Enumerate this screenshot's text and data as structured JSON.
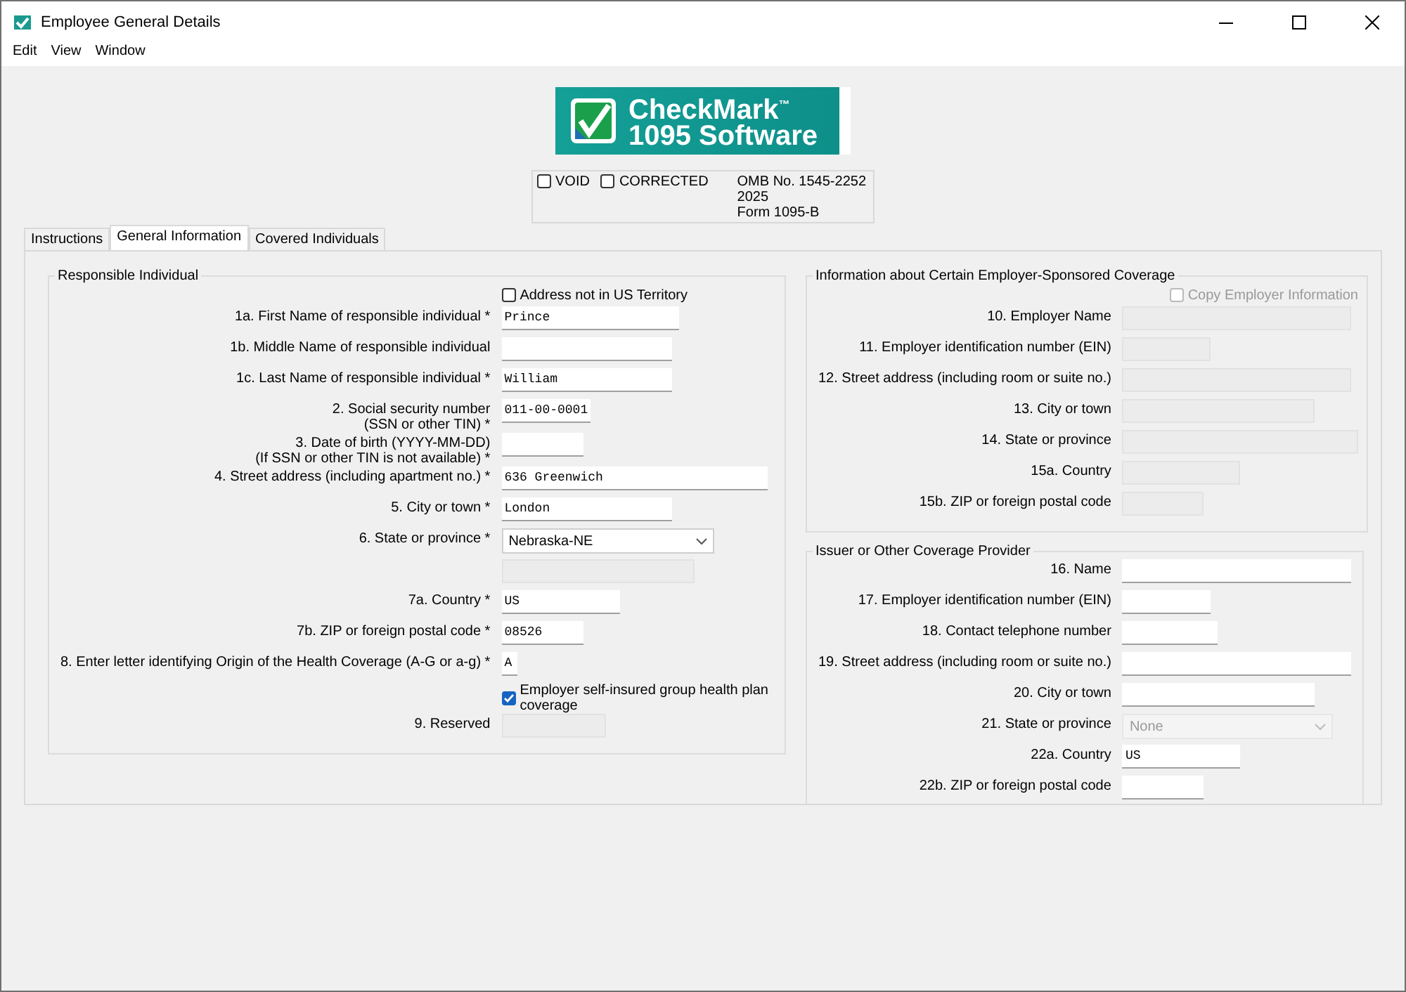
{
  "window": {
    "title": "Employee General Details"
  },
  "menu": [
    "Edit",
    "View",
    "Window"
  ],
  "logo": {
    "brand": "CheckMark$^{™}$",
    "product": "1095 Software"
  },
  "form_box": {
    "checkboxes": [
      {
        "label": "VOID",
        "checked": false
      },
      {
        "label": "CORRECTED",
        "checked": false
      }
    ],
    "info": [
      "OMB No. 1545-2252",
      "2025",
      "Form 1095-B"
    ]
  },
  "tabs": [
    {
      "label": "Instructions",
      "selected": false
    },
    {
      "label": "General Information",
      "selected": true
    },
    {
      "label": "Covered Individuals",
      "selected": false
    }
  ],
  "responsible_individual": {
    "title": "Responsible Individual",
    "rows": [
      {
        "kind": "checkbox",
        "label": "Address not in US Territory",
        "checked": false,
        "disabled": false
      },
      {
        "kind": "text",
        "label": "1a. First Name of responsible individual *",
        "value": "Prince",
        "disabled": false
      },
      {
        "kind": "text",
        "label": "1b. Middle Name of responsible individual",
        "disabled": false
      },
      {
        "kind": "text",
        "label": "1c. Last Name of responsible individual *",
        "value": "William",
        "disabled": false
      },
      {
        "kind": "text",
        "label": "2. Social security number\n(SSN or other TIN) *",
        "value": "011-00-0001",
        "disabled": false
      },
      {
        "kind": "text",
        "label": "3. Date of birth (YYYY-MM-DD)\n(If SSN or other TIN is not available) *",
        "disabled": false
      },
      {
        "kind": "text",
        "label": "4. Street address (including apartment no.) *",
        "value": "636 Greenwich",
        "disabled": false
      },
      {
        "kind": "text",
        "label": "5. City or town *",
        "value": "London",
        "disabled": false
      },
      {
        "kind": "select",
        "label": "6. State or province *",
        "value": "Nebraska-NE",
        "disabled": false
      },
      {
        "kind": "text",
        "disabled": true
      },
      {
        "kind": "text",
        "label": "7a. Country *",
        "value": "US",
        "disabled": false
      },
      {
        "kind": "text",
        "label": "7b. ZIP or foreign postal code *",
        "value": "08526",
        "disabled": false
      },
      {
        "kind": "text",
        "label": "8. Enter letter identifying Origin of the Health Coverage (A-G or a-g) *",
        "value": "A",
        "disabled": false
      },
      {
        "kind": "checkbox",
        "label": "Employer self-insured group health plan coverage",
        "checked": true,
        "disabled": false
      },
      {
        "kind": "text",
        "label": "9. Reserved",
        "disabled": true
      }
    ]
  },
  "employer_coverage": {
    "title": "Information about Certain Employer-Sponsored Coverage",
    "rows": [
      {
        "kind": "checkbox",
        "label": "Copy Employer Information",
        "checked": false,
        "disabled": true
      },
      {
        "kind": "text",
        "label": "10. Employer Name",
        "disabled": true
      },
      {
        "kind": "text",
        "label": "11. Employer identification number (EIN)",
        "disabled": true
      },
      {
        "kind": "text",
        "label": "12. Street address (including room or suite no.)",
        "disabled": true
      },
      {
        "kind": "text",
        "label": "13. City or town",
        "disabled": true
      },
      {
        "kind": "text",
        "label": "14. State or province",
        "disabled": true
      },
      {
        "kind": "text",
        "label": "15a. Country",
        "disabled": true
      },
      {
        "kind": "text",
        "label": "15b. ZIP or foreign postal code",
        "disabled": true
      }
    ]
  },
  "issuer": {
    "title": "Issuer or Other Coverage Provider",
    "rows": [
      {
        "kind": "text",
        "label": "16. Name",
        "disabled": false
      },
      {
        "kind": "text",
        "label": "17. Employer identification number (EIN)",
        "disabled": false
      },
      {
        "kind": "text",
        "label": "18. Contact telephone number",
        "disabled": false
      },
      {
        "kind": "text",
        "label": "19. Street address (including room or suite no.)",
        "disabled": false
      },
      {
        "kind": "text",
        "label": "20. City or town",
        "disabled": false
      },
      {
        "kind": "select",
        "label": "21. State or province",
        "value": "None",
        "disabled": true
      },
      {
        "kind": "text",
        "label": "22a. Country",
        "value": "US",
        "disabled": false
      },
      {
        "kind": "text",
        "label": "22b. ZIP or foreign postal code",
        "disabled": false
      }
    ]
  }
}
